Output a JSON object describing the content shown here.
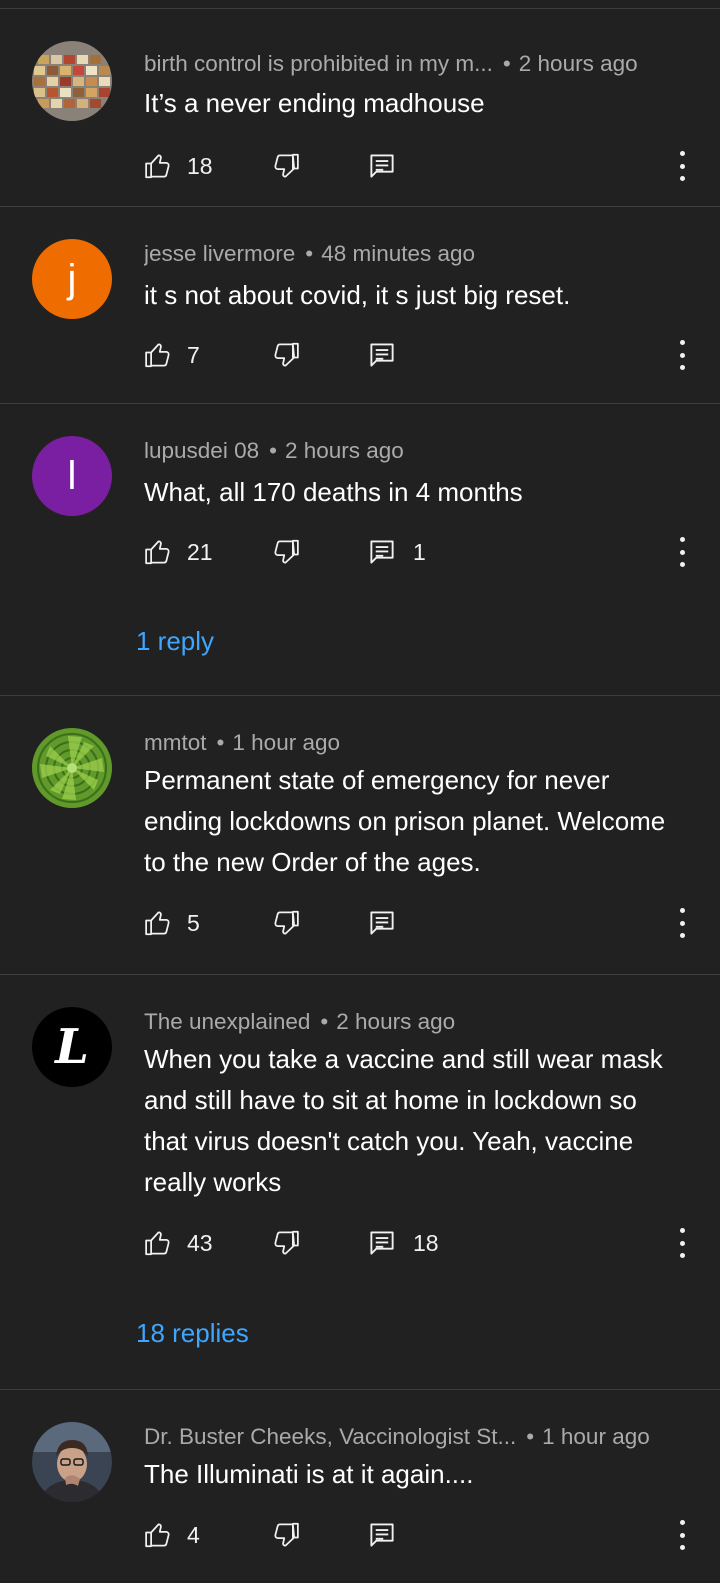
{
  "comments": [
    {
      "author": "birth control is prohibited in my m...",
      "time": "2 hours ago",
      "text": "It’s a never ending madhouse",
      "likes": "18",
      "reply_count": "",
      "avatar": {
        "type": "image",
        "icon": "photo-grid-avatar-icon"
      }
    },
    {
      "author": "jesse livermore",
      "time": "48 minutes ago",
      "text": "it s not about covid, it s just big reset.",
      "likes": "7",
      "reply_count": "",
      "avatar": {
        "type": "letter",
        "letter": "j",
        "color": "#ef6c00"
      }
    },
    {
      "author": "lupusdei 08",
      "time": "2 hours ago",
      "text": "What, all 170 deaths in 4 months",
      "likes": "21",
      "reply_count": "1",
      "replies_link": "1 reply",
      "avatar": {
        "type": "letter",
        "letter": "l",
        "color": "#7b1fa2"
      }
    },
    {
      "author": "mmtot",
      "time": "1 hour ago",
      "text": "Permanent state of emergency for never ending lockdowns on prison planet. Welcome to the new Order of the ages.",
      "likes": "5",
      "reply_count": "",
      "avatar": {
        "type": "image",
        "icon": "succulent-avatar-icon"
      }
    },
    {
      "author": "The unexplained",
      "time": "2 hours ago",
      "text": "When you take a vaccine and still wear mask and still have to sit at home in lockdown so that virus doesn't catch you. Yeah, vaccine really works",
      "likes": "43",
      "reply_count": "18",
      "replies_link": "18 replies",
      "avatar": {
        "type": "letter",
        "letter": "L",
        "color": "#000000"
      }
    },
    {
      "author": "Dr. Buster Cheeks, Vaccinologist St...",
      "time": "1 hour ago",
      "text": "The Illuminati is at it again....",
      "likes": "4",
      "reply_count": "",
      "avatar": {
        "type": "image",
        "icon": "person-photo-avatar-icon"
      }
    }
  ],
  "colors": {
    "background": "#212121",
    "divider": "#3d3d3d",
    "meta_text": "#aaaaaa",
    "link": "#3ea6ff"
  }
}
